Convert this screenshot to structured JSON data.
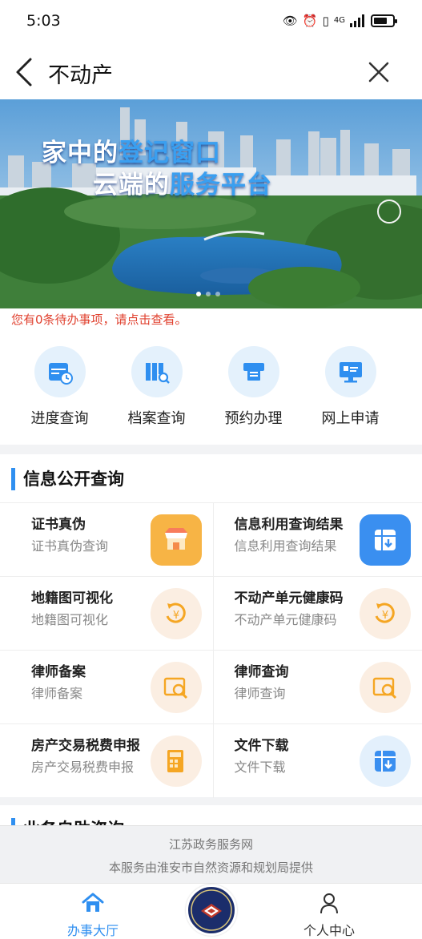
{
  "status": {
    "time": "5:03",
    "network": "4G"
  },
  "nav": {
    "title": "不动产"
  },
  "banner": {
    "line1_a": "家中的",
    "line1_b": "登记窗口",
    "line2_a": "云端的",
    "line2_b": "服务平台"
  },
  "pending_notice": "您有0条待办事项，请点击查看。",
  "quick_actions": [
    {
      "label": "进度查询",
      "icon": "calendar-clock-icon"
    },
    {
      "label": "档案查询",
      "icon": "archive-search-icon"
    },
    {
      "label": "预约办理",
      "icon": "ticket-machine-icon"
    },
    {
      "label": "网上申请",
      "icon": "monitor-apply-icon"
    }
  ],
  "info_section": {
    "title": "信息公开查询",
    "items": [
      {
        "title": "证书真伪",
        "subtitle": "证书真伪查询",
        "icon": "shop-icon"
      },
      {
        "title": "信息利用查询结果",
        "subtitle": "信息利用查询结果",
        "icon": "download-table-icon"
      },
      {
        "title": "地籍图可视化",
        "subtitle": "地籍图可视化",
        "icon": "yuan-cycle-icon"
      },
      {
        "title": "不动产单元健康码",
        "subtitle": "不动产单元健康码",
        "icon": "yuan-cycle-icon"
      },
      {
        "title": "律师备案",
        "subtitle": "律师备案",
        "icon": "ems-search-icon"
      },
      {
        "title": "律师查询",
        "subtitle": "律师查询",
        "icon": "ems-search-icon"
      },
      {
        "title": "房产交易税费申报",
        "subtitle": "房产交易税费申报",
        "icon": "tax-calculator-icon"
      },
      {
        "title": "文件下载",
        "subtitle": "文件下载",
        "icon": "download-table-icon"
      }
    ]
  },
  "next_section": {
    "title": "业务自助咨询"
  },
  "footer": {
    "line1": "江苏政务服务网",
    "line2": "本服务由淮安市自然资源和规划局提供"
  },
  "tabs": {
    "home": "办事大厅",
    "me": "个人中心"
  },
  "colors": {
    "accent": "#2f8ff0",
    "notice": "#e0412f",
    "orange": "#f5a623"
  }
}
